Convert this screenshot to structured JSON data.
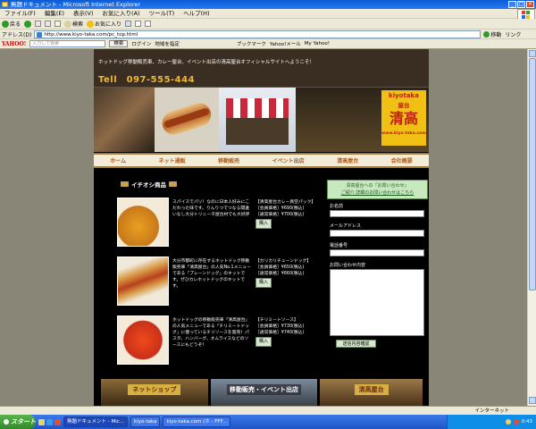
{
  "window": {
    "title": "無題ドキュメント - Microsoft Internet Explorer"
  },
  "menu": [
    "ファイル(F)",
    "編集(E)",
    "表示(V)",
    "お気に入り(A)",
    "ツール(T)",
    "ヘルプ(H)"
  ],
  "toolbar": {
    "back": "戻る",
    "search": "検索",
    "favorites": "お気に入り"
  },
  "address": {
    "label": "アドレス(D)",
    "url": "http://www.kiyo-taka.com/pc_top.html",
    "go": "移動",
    "links": "リンク"
  },
  "yahoo": {
    "logo": "YAHOO!",
    "placeholder": "入力して検索",
    "search": "検索",
    "items": [
      "ログイン",
      "地域を指定",
      "ブックマーク",
      "Yahoo!メール",
      "My Yahoo!"
    ]
  },
  "site": {
    "welcome": "ホットドッグ移動販売車、カレー屋台、イベント出店の清高屋台オフィシャルサイトへようこそ！",
    "tel": "Tell　097-555-444",
    "logo": {
      "l1": "kiyotaka",
      "l2": "屋台",
      "l3": "清高",
      "l4": "www.kiyo-taka.com"
    },
    "nav": [
      "ホーム",
      "ネット通販",
      "移動販売",
      "イベント出店",
      "清高屋台",
      "会社概要"
    ],
    "section_title": "イチオシ商品",
    "products": [
      {
        "desc": "スパイスでパリ！なのに日本人好みにこだわった味です。りんりつでつなる間違いなし大分トリニータ屋台村でも大好評",
        "name": "【清高屋台カレー真空パック】",
        "member": "［会員価格］¥690(税込)",
        "regular": "［通常価格］¥700(税込)",
        "buy": "購入"
      },
      {
        "desc": "大分市都町に存在するホットドッグ移動販売車「清高屋台」の人気No.1メニューである「プレーンドッグ」のキットです。ぜひカレホットドッグのキットです。",
        "name": "【カリカリチューンドッグ】",
        "member": "［会員価格］¥650(税込)",
        "regular": "［通常価格］¥660(税込)",
        "buy": "購入"
      },
      {
        "desc": "ホットドッグの移動販売車「清高屋台」の人気メニューである「チリミートドッグ」に使っているチリソースを発売！パスタ、ハンバーグ、オムライスなどのソースにもどうぞ！",
        "name": "【チリミートソース】",
        "member": "［会員価格］¥730(税込)",
        "regular": "［通常価格］¥740(税込)",
        "buy": "購入"
      }
    ],
    "sidebar": {
      "head1": "清高屋台への「お問い合わせ」",
      "head2": "ご紹介 詳細のお問い合わせはこちら",
      "name_label": "お名前",
      "email_label": "メールアドレス",
      "phone_label": "電話番号",
      "msg_label": "お問い合わせ内容",
      "submit": "送信内容確認"
    },
    "bottom_nav": [
      "ネットショップ",
      "移動販売・イベント出店",
      "清高屋台"
    ]
  },
  "statusbar": {
    "zone": "インターネット"
  },
  "taskbar": {
    "start": "スタート",
    "tasks": [
      "無題ドキュメント - Mic...",
      "kiyo-taka",
      "kiyo-taka.com (ホ - FFF..."
    ],
    "clock": "0:43"
  }
}
